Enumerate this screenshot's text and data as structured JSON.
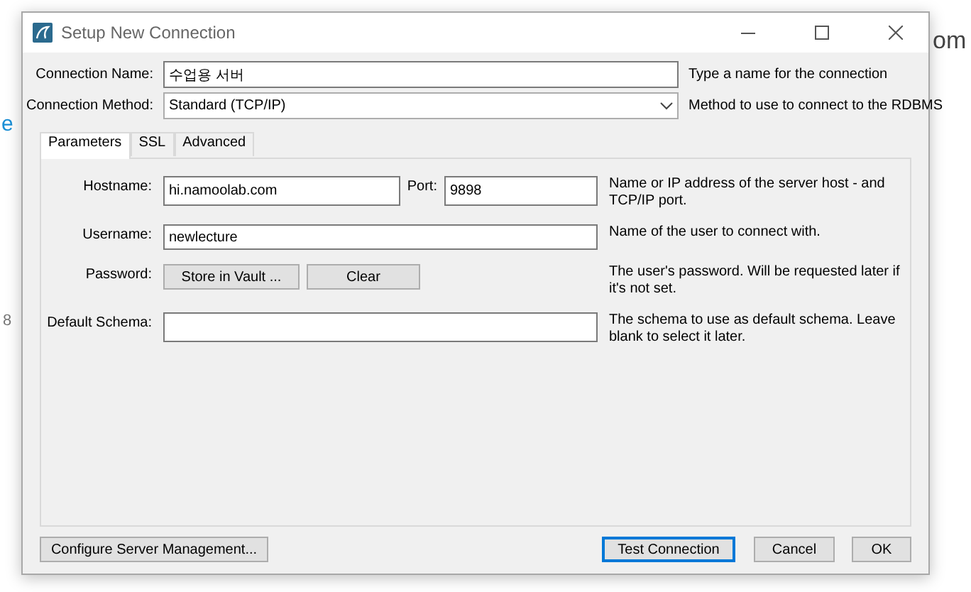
{
  "background_texts": [
    "om",
    "e",
    "8"
  ],
  "window": {
    "title": "Setup New Connection"
  },
  "connection_name": {
    "label": "Connection Name:",
    "value": "수업용 서버",
    "hint": "Type a name for the connection"
  },
  "connection_method": {
    "label": "Connection Method:",
    "value": "Standard (TCP/IP)",
    "hint": "Method to use to connect to the RDBMS"
  },
  "tabs": [
    {
      "label": "Parameters",
      "selected": true
    },
    {
      "label": "SSL",
      "selected": false
    },
    {
      "label": "Advanced",
      "selected": false
    }
  ],
  "parameters": {
    "hostname": {
      "label": "Hostname:",
      "value": "hi.namoolab.com"
    },
    "port": {
      "label": "Port:",
      "value": "9898"
    },
    "host_hint": "Name or IP address of the server host - and TCP/IP port.",
    "username": {
      "label": "Username:",
      "value": "newlecture",
      "hint": "Name of the user to connect with."
    },
    "password": {
      "label": "Password:",
      "buttons": [
        "Store in Vault ...",
        "Clear"
      ],
      "hint": "The user's password. Will be requested later if it's not set."
    },
    "default_schema": {
      "label": "Default Schema:",
      "hint": "The schema to use as default schema. Leave blank to select it later."
    }
  },
  "left_buttons": [
    {
      "label": "Configure Server Management...",
      "focused": false
    }
  ],
  "right_buttons": [
    {
      "label": "Test Connection",
      "focused": true
    },
    {
      "label": "Cancel",
      "focused": false
    },
    {
      "label": "OK",
      "focused": false
    }
  ]
}
